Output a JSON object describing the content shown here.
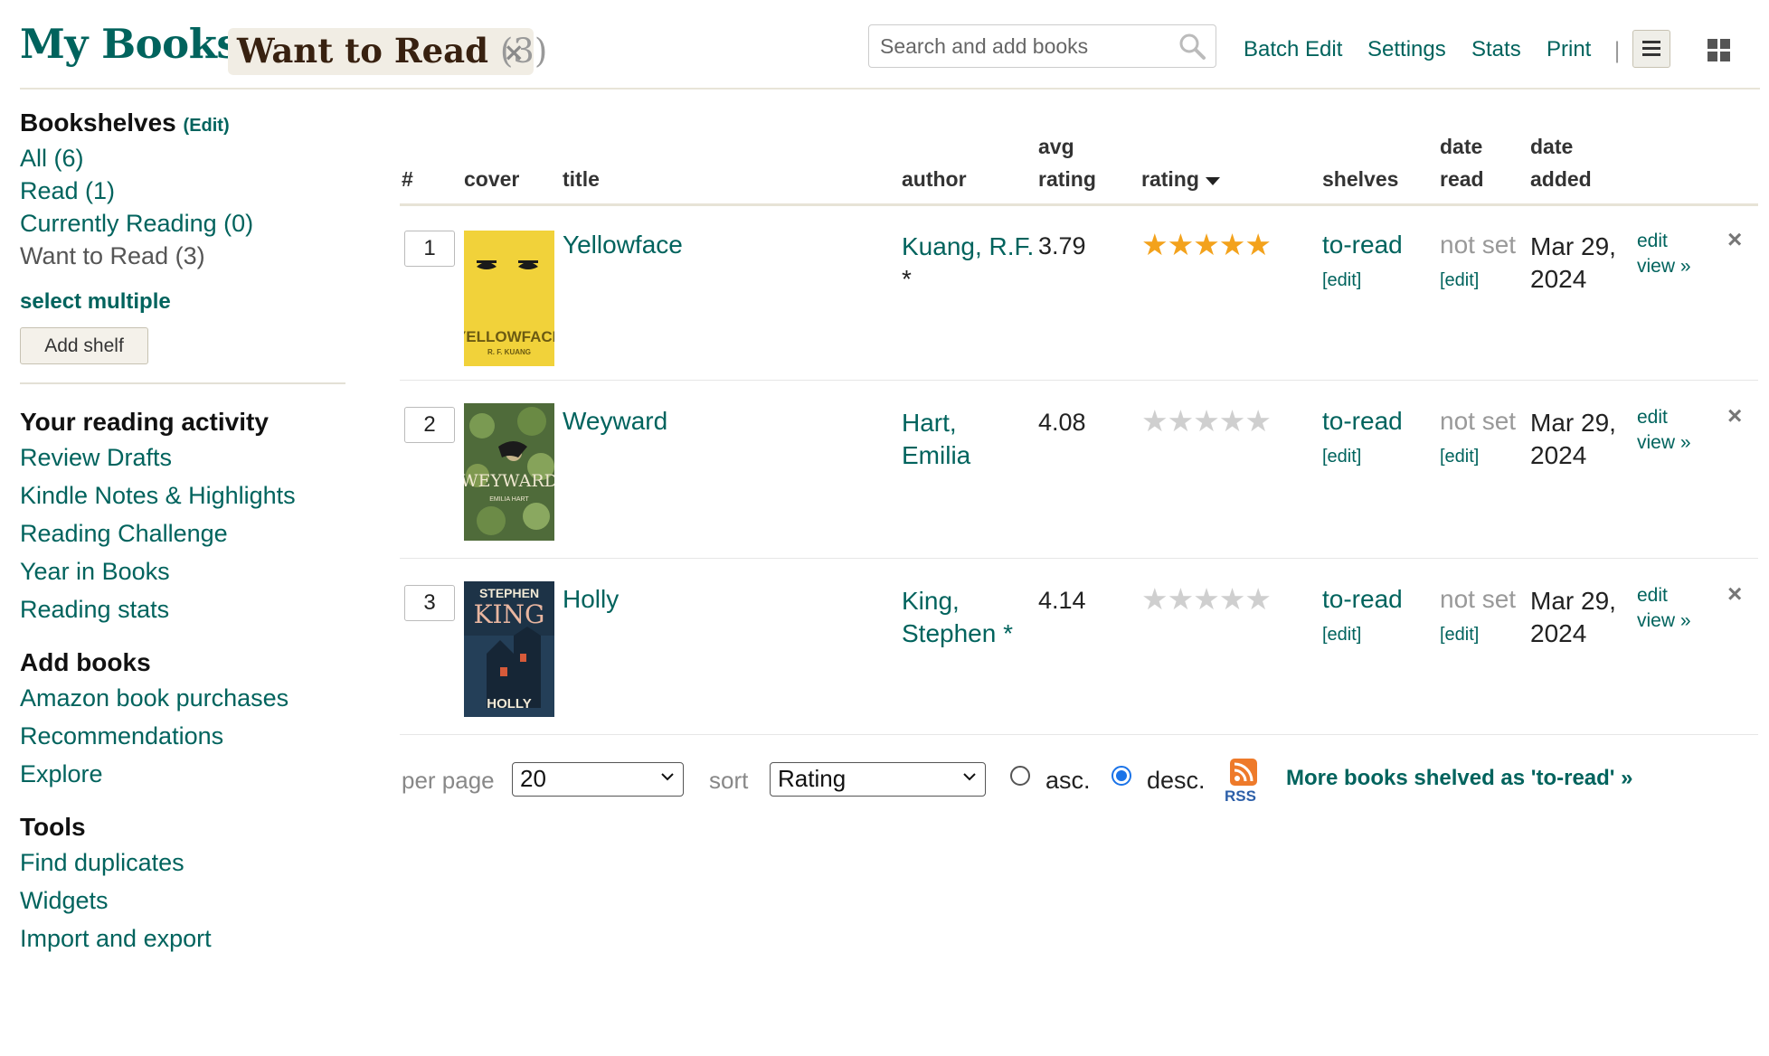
{
  "header": {
    "title": "My Books:",
    "shelf_name": "Want to Read",
    "shelf_count": "(3)",
    "close_glyph": "×",
    "search_placeholder": "Search and add books",
    "links": {
      "batch_edit": "Batch Edit",
      "settings": "Settings",
      "stats": "Stats",
      "print": "Print"
    },
    "separator": "|"
  },
  "sidebar": {
    "bookshelves_heading": "Bookshelves",
    "bookshelves_edit": "(Edit)",
    "shelves": [
      {
        "label": "All (6)"
      },
      {
        "label": "Read (1)"
      },
      {
        "label": "Currently Reading (0)"
      },
      {
        "label": "Want to Read (3)"
      }
    ],
    "select_multiple": "select multiple",
    "add_shelf": "Add shelf",
    "activity_heading": "Your reading activity",
    "activity_links": [
      "Review Drafts",
      "Kindle Notes & Highlights",
      "Reading Challenge",
      "Year in Books",
      "Reading stats"
    ],
    "add_books_heading": "Add books",
    "add_books_links": [
      "Amazon book purchases",
      "Recommendations",
      "Explore"
    ],
    "tools_heading": "Tools",
    "tools_links": [
      "Find duplicates",
      "Widgets",
      "Import and export"
    ]
  },
  "table": {
    "columns": {
      "num": "#",
      "cover": "cover",
      "title": "title",
      "author": "author",
      "avg_line1": "avg",
      "avg_line2": "rating",
      "rating": "rating",
      "shelves": "shelves",
      "date_read_line1": "date",
      "date_read_line2": "read",
      "date_added_line1": "date",
      "date_added_line2": "added"
    },
    "rows": [
      {
        "position": "1",
        "cover_title": "YELLOWFACE",
        "cover_author": "R. F. KUANG",
        "title": "Yellowface",
        "author_line1": "Kuang, R.F.",
        "author_line2": "*",
        "avg_rating": "3.79",
        "user_rating": 5,
        "shelf": "to-read",
        "shelf_edit": "[edit]",
        "date_read": "not set",
        "date_read_edit": "[edit]",
        "date_added_line1": "Mar 29,",
        "date_added_line2": "2024",
        "edit": "edit",
        "view": "view »"
      },
      {
        "position": "2",
        "cover_title": "WEYWARD",
        "cover_author": "EMILIA HART",
        "title": "Weyward",
        "author_line1": "Hart,",
        "author_line2": "Emilia",
        "avg_rating": "4.08",
        "user_rating": 0,
        "shelf": "to-read",
        "shelf_edit": "[edit]",
        "date_read": "not set",
        "date_read_edit": "[edit]",
        "date_added_line1": "Mar 29,",
        "date_added_line2": "2024",
        "edit": "edit",
        "view": "view »"
      },
      {
        "position": "3",
        "cover_title": "HOLLY",
        "cover_author_top1": "STEPHEN",
        "cover_author_top2": "KING",
        "title": "Holly",
        "author_line1": "King,",
        "author_line2": "Stephen *",
        "avg_rating": "4.14",
        "user_rating": 0,
        "shelf": "to-read",
        "shelf_edit": "[edit]",
        "date_read": "not set",
        "date_read_edit": "[edit]",
        "date_added_line1": "Mar 29,",
        "date_added_line2": "2024",
        "edit": "edit",
        "view": "view »"
      }
    ]
  },
  "controls": {
    "per_page_label": "per page",
    "per_page_value": "20",
    "sort_label": "sort",
    "sort_value": "Rating",
    "asc_label": "asc.",
    "desc_label": "desc.",
    "order_selected": "desc.",
    "rss_label": "RSS",
    "more_books": "More books shelved as 'to-read' »"
  },
  "colors": {
    "brand_green": "#00635d",
    "title_brown": "#382110",
    "chip_bg": "#f1ede4",
    "star_filled": "#f3a21c",
    "star_empty": "#cfcfcf"
  },
  "icons": {
    "search": "search-icon",
    "close": "close-icon",
    "list_view": "list-view-icon",
    "grid_view": "grid-view-icon",
    "sort_desc": "caret-down-icon",
    "rss": "rss-icon",
    "remove": "remove-icon",
    "chevron": "chevron-down-icon"
  }
}
